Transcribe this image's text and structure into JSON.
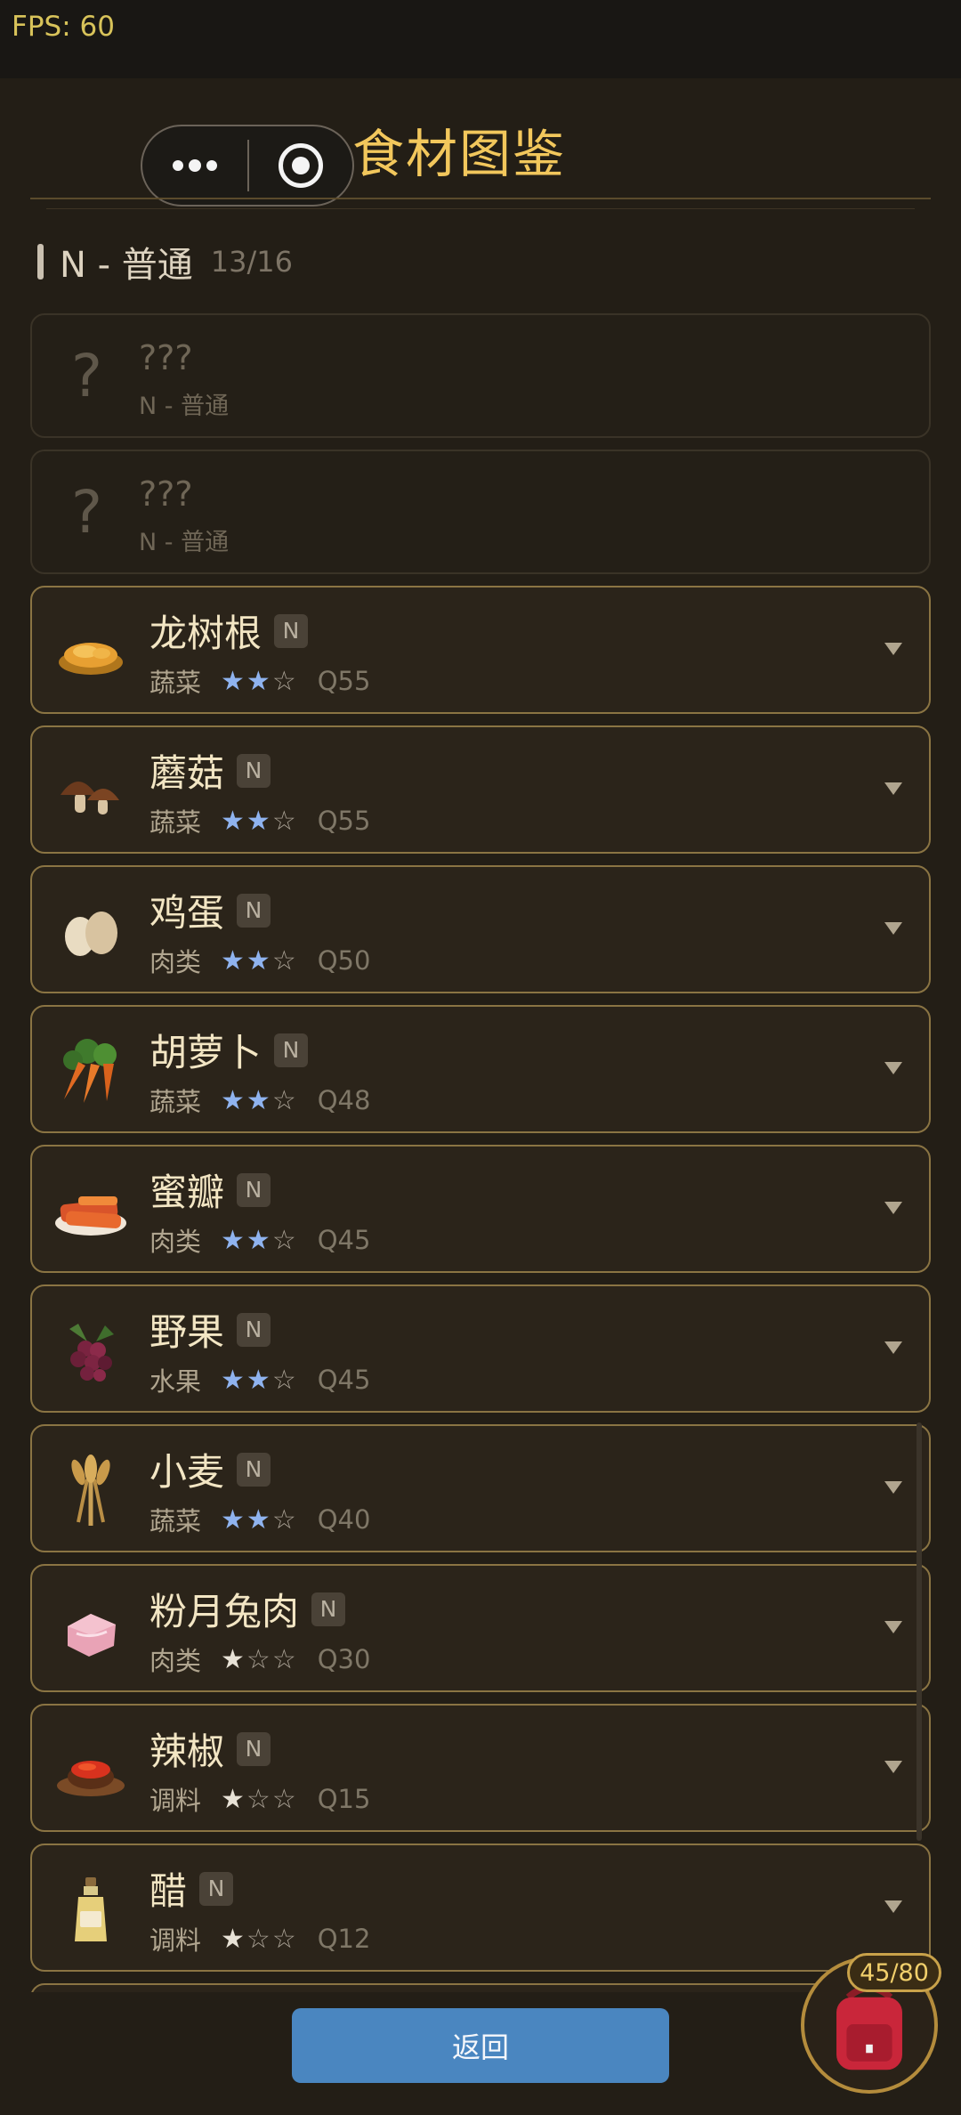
{
  "status": {
    "fps": "FPS: 60"
  },
  "header": {
    "title": "食材图鉴"
  },
  "section": {
    "name": "N - 普通",
    "count": "13/16"
  },
  "unknown_items": [
    {
      "name": "???",
      "rarity": "N - 普通"
    },
    {
      "name": "???",
      "rarity": "N - 普通"
    }
  ],
  "items": [
    {
      "name": "龙树根",
      "badge": "N",
      "category": "蔬菜",
      "stars": 2,
      "quality": "Q55",
      "icon": "dragon-tree-root-icon"
    },
    {
      "name": "蘑菇",
      "badge": "N",
      "category": "蔬菜",
      "stars": 2,
      "quality": "Q55",
      "icon": "mushroom-icon"
    },
    {
      "name": "鸡蛋",
      "badge": "N",
      "category": "肉类",
      "stars": 2,
      "quality": "Q50",
      "icon": "egg-icon"
    },
    {
      "name": "胡萝卜",
      "badge": "N",
      "category": "蔬菜",
      "stars": 2,
      "quality": "Q48",
      "icon": "carrot-icon"
    },
    {
      "name": "蜜瓣",
      "badge": "N",
      "category": "肉类",
      "stars": 2,
      "quality": "Q45",
      "icon": "honey-petal-icon"
    },
    {
      "name": "野果",
      "badge": "N",
      "category": "水果",
      "stars": 2,
      "quality": "Q45",
      "icon": "wild-berry-icon"
    },
    {
      "name": "小麦",
      "badge": "N",
      "category": "蔬菜",
      "stars": 2,
      "quality": "Q40",
      "icon": "wheat-icon"
    },
    {
      "name": "粉月兔肉",
      "badge": "N",
      "category": "肉类",
      "stars": 1,
      "quality": "Q30",
      "icon": "rabbit-meat-icon"
    },
    {
      "name": "辣椒",
      "badge": "N",
      "category": "调料",
      "stars": 1,
      "quality": "Q15",
      "icon": "chili-icon"
    },
    {
      "name": "醋",
      "badge": "N",
      "category": "调料",
      "stars": 1,
      "quality": "Q12",
      "icon": "vinegar-icon"
    }
  ],
  "star_colors": {
    "two_star": "#8fb3ef",
    "one_star": "#e8e2d6"
  },
  "footer": {
    "back_label": "返回"
  },
  "bag": {
    "count": "45/80"
  }
}
